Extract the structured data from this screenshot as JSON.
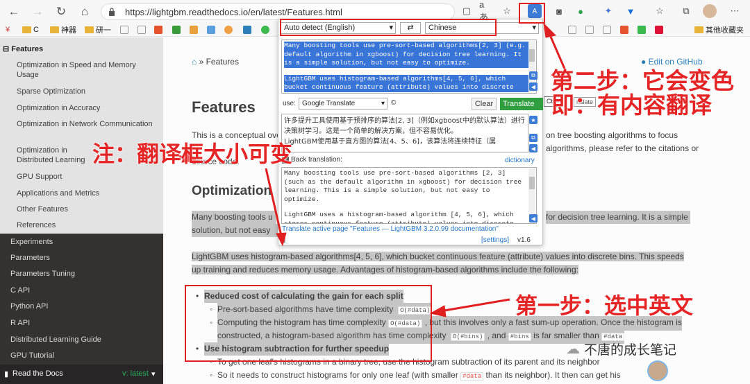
{
  "browser": {
    "url": "https://lightgbm.readthedocs.io/en/latest/Features.html",
    "bookmarks": [
      "C",
      "神器",
      "研一",
      "其他收藏夹"
    ]
  },
  "sidebar": {
    "header": "Features",
    "items": [
      "Optimization in Speed and Memory Usage",
      "Sparse Optimization",
      "Optimization in Accuracy",
      "Optimization in Network Communication",
      "Optimization in Distributed Learning",
      "GPU Support",
      "Applications and Metrics",
      "Other Features",
      "References"
    ],
    "sections": [
      "Experiments",
      "Parameters",
      "Parameters Tuning",
      "C API",
      "Python API",
      "R API",
      "Distributed Learning Guide",
      "GPU Tutorial"
    ],
    "footer": {
      "label": "Read the Docs",
      "version": "v: latest"
    }
  },
  "content": {
    "breadcrumb": "» Features",
    "edit_link": "Edit on GitHub",
    "title": "Features",
    "intro": "This is a conceptual overview of how LightGBM works",
    "intro_right_1": "on tree boosting algorithms to focus",
    "intro_right_2": "algorithms, please refer to the citations or",
    "intro_line3": "source code.",
    "section_heading": "Optimization",
    "p1_left": "Many boosting tools u",
    "p1_right": "for decision tree learning. It is a simple",
    "p1_line2": "solution, but not easy",
    "p2_line1": "LightGBM uses histogram-based algorithms[4, 5, 6], which bucket continuous feature (attribute) values into discrete bins. This speeds",
    "p2_line2": "up training and reduces memory usage. Advantages of histogram-based algorithms include the following:",
    "b1": "Reduced cost of calculating the gain for each split",
    "b1_sub1": "Pre-sort-based algorithms have time complexity",
    "code1": "O(#data)",
    "b1_sub2_a": "Computing the histogram has time complexity",
    "code2": "O(#data)",
    "b1_sub2_b": ", but this involves only a fast sum-up operation. Once the histogram is",
    "b1_sub2_c": "constructed, a histogram-based algorithm has time complexity",
    "code3": "O(#bins)",
    "b1_sub2_d": ", and",
    "code4": "#bins",
    "b1_sub2_e": "is far smaller than",
    "code5": "#data",
    "b2": "Use histogram subtraction for further speedup",
    "b2_sub1": "To get one leaf's histograms in a binary tree, use the histogram subtraction of its parent and its neighbor",
    "b2_sub2_a": "So it needs to construct histograms for only one leaf (with smaller",
    "code6": "#data",
    "b2_sub2_b": "than its neighbor). It then can get his"
  },
  "translator": {
    "source_lang": "Auto detect (English)",
    "swap": "⇄",
    "target_lang": "Chinese",
    "source_text_1": "Many boosting tools use pre-sort-based algorithms[2, 3] (e.g. default algorithm in xgboost) for decision tree learning. It is a simple solution, but not easy to optimize.",
    "source_text_2": "LightGBM uses histogram-based algorithms[4, 5, 6], which bucket continuous feature (attribute) values into discrete",
    "use_label": "use:",
    "engine": "Google Translate",
    "clear": "Clear",
    "translate": "Translate",
    "shortcut": "Ctrl+",
    "tooltip": "nslate",
    "result_1": "许多提升工具使用基于预排序的算法[2, 3]（例如xgboost中的默认算法）进行决策树学习。这是一个简单的解决方案，但不容易优化。",
    "result_2": "LightGBM使用基于直方图的算法[4、5、6]，该算法将连续特征（属",
    "back_label": "Back translation:",
    "dictionary": "dictionary",
    "back_text_1": "Many boosting tools use pre-sort-based algorithms [2, 3] (such as the default algorithm in xgboost) for decision tree learning. This is a simple solution, but not easy to optimize.",
    "back_text_2": "LightGBM uses a histogram-based algorithm [4, 5, 6], which stores continuous feature (attribute) values into discrete",
    "active_page": "Translate active page \"Features — LightGBM 3.2.0.99 documentation\"",
    "settings": "[settings]",
    "version": "v1.6"
  },
  "annotations": {
    "step2_line1": "第二步：它会变色",
    "step2_line2": "即：有内容翻译",
    "note": "注：翻译框大小可变",
    "step1": "第一步：选中英文"
  },
  "watermark": "不唐的成长笔记",
  "colors": {
    "annotation": "#e02020",
    "sidebar_dark": "#343131",
    "link": "#2980b9",
    "translate_btn": "#2e9e3e"
  }
}
